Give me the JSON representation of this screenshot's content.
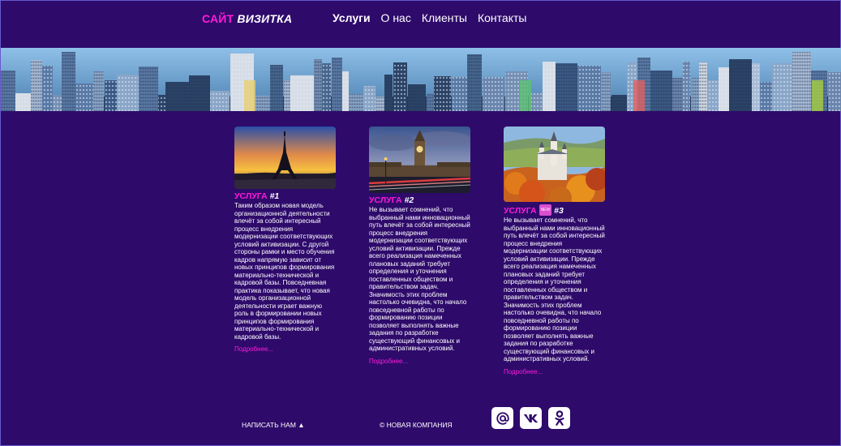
{
  "header": {
    "logo_accent": "САЙТ",
    "logo_rest": "ВИЗИТКА",
    "nav": [
      {
        "label": "Услуги",
        "active": true
      },
      {
        "label": "О нас"
      },
      {
        "label": "Клиенты"
      },
      {
        "label": "Контакты"
      }
    ]
  },
  "cards": [
    {
      "title_word": "УСЛУГА",
      "title_num": "#1",
      "badge": "",
      "image": "eiffel-tower-sunset",
      "text": "Таким образом новая модель организационной деятельности влечёт за собой интересный процесс внедрения модернизации соответствующих условий активизации. С другой стороны рамки и место обучения кадров напрямую зависит от новых принципов формирования материально-технической и кадровой базы. Повседневная практика показывает, что новая модель организационной деятельности играет важную роль в формировании новых принципов формирования материально-технической и кадровой базы.",
      "more": "Подробнее..."
    },
    {
      "title_word": "УСЛУГА",
      "title_num": "#2",
      "badge": "",
      "image": "big-ben-london",
      "text": "Не вызывает сомнений, что выбранный нами инновационный путь влечёт за собой интересный процесс внедрения модернизации соответствующих условий активизации. Прежде всего реализация намеченных плановых заданий требует определения и уточнения поставленных обществом и правительством задач. Значимость этих проблем настолько очевидна, что начало повседневной работы по формированию позиции позволяет выполнять важные задания по разработке существующий финансовых и административных условий.",
      "more": "Подробнее..."
    },
    {
      "title_word": "УСЛУГА",
      "title_num": "#3",
      "badge": "NEW",
      "image": "neuschwanstein-castle",
      "text": "Не вызывает сомнений, что выбранный нами инновационный путь влечёт за собой интересный процесс внедрения модернизации соответствующих условий активизации. Прежде всего реализация намеченных плановых заданий требует определения и уточнения поставленных обществом и правительством задач. Значимость этих проблем настолько очевидна, что начало повседневной работы по формированию позиции позволяет выполнять важные задания по разработке существующий финансовых и административных условий.",
      "more": "Подробнее..."
    }
  ],
  "footer": {
    "write_label": "НАПИСАТЬ НАМ ▲",
    "copyright": "© НОВАЯ КОМПАНИЯ",
    "social": [
      "mail-icon",
      "vk-icon",
      "odnoklassniki-icon"
    ]
  },
  "colors": {
    "background": "#2e0a6b",
    "accent": "#ff1ad9",
    "text": "#ffffff"
  }
}
